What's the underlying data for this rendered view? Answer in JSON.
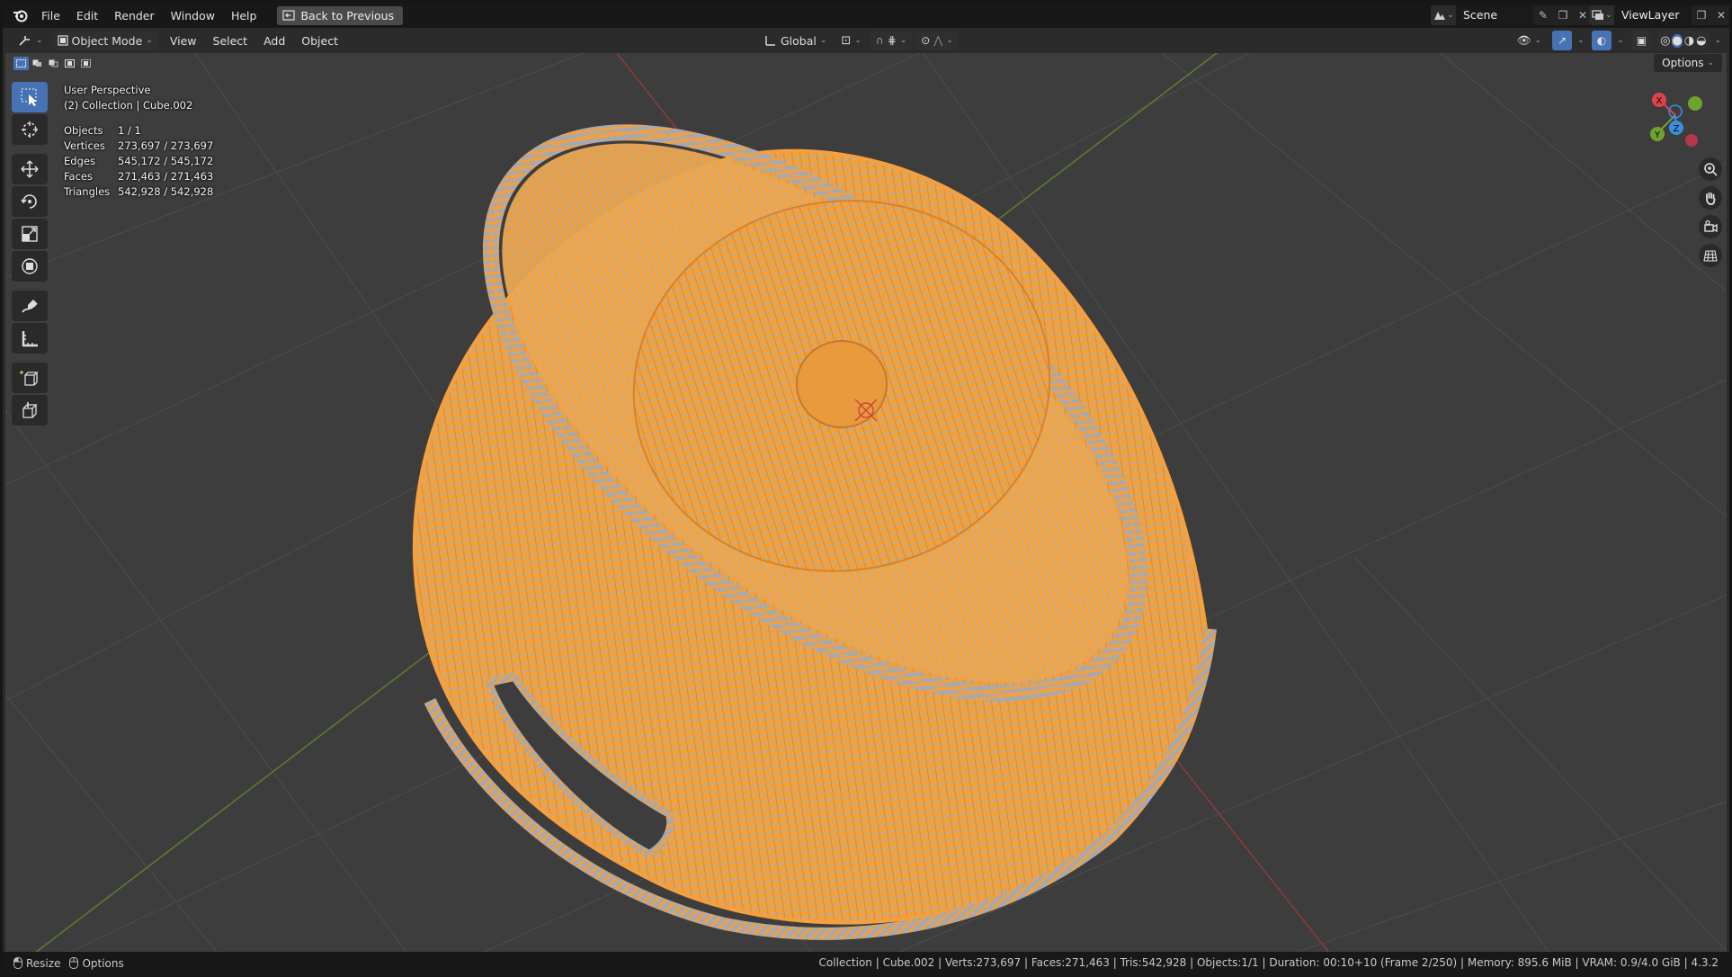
{
  "menubar": {
    "items": [
      "File",
      "Edit",
      "Render",
      "Window",
      "Help"
    ],
    "back_button": "Back to Previous",
    "scene_name": "Scene",
    "view_layer": "ViewLayer"
  },
  "viewport_header": {
    "mode": "Object Mode",
    "menus": [
      "View",
      "Select",
      "Add",
      "Object"
    ],
    "transform_orientation": "Global",
    "options_label": "Options"
  },
  "overlay": {
    "perspective": "User Perspective",
    "collection": "(2) Collection | Cube.002",
    "stats": [
      {
        "label": "Objects",
        "value": "1 / 1"
      },
      {
        "label": "Vertices",
        "value": "273,697 / 273,697"
      },
      {
        "label": "Edges",
        "value": "545,172 / 545,172"
      },
      {
        "label": "Faces",
        "value": "271,463 / 271,463"
      },
      {
        "label": "Triangles",
        "value": "542,928 / 542,928"
      }
    ]
  },
  "gizmo": {
    "x": "X",
    "y": "Y",
    "z": "Z"
  },
  "statusbar": {
    "left_1": "Resize",
    "left_2": "Options",
    "right": "Collection | Cube.002 | Verts:273,697 | Faces:271,463 | Tris:542,928 | Objects:1/1 | Duration: 00:10+10 (Frame 2/250) | Memory: 895.6 MiB | VRAM: 0.9/4.0 GiB | 4.3.2"
  },
  "colors": {
    "selection_orange": "#f5a040",
    "axis_x": "#e0424d",
    "axis_y": "#6fa330",
    "axis_z": "#3a8fe0",
    "accent": "#4772b3"
  }
}
